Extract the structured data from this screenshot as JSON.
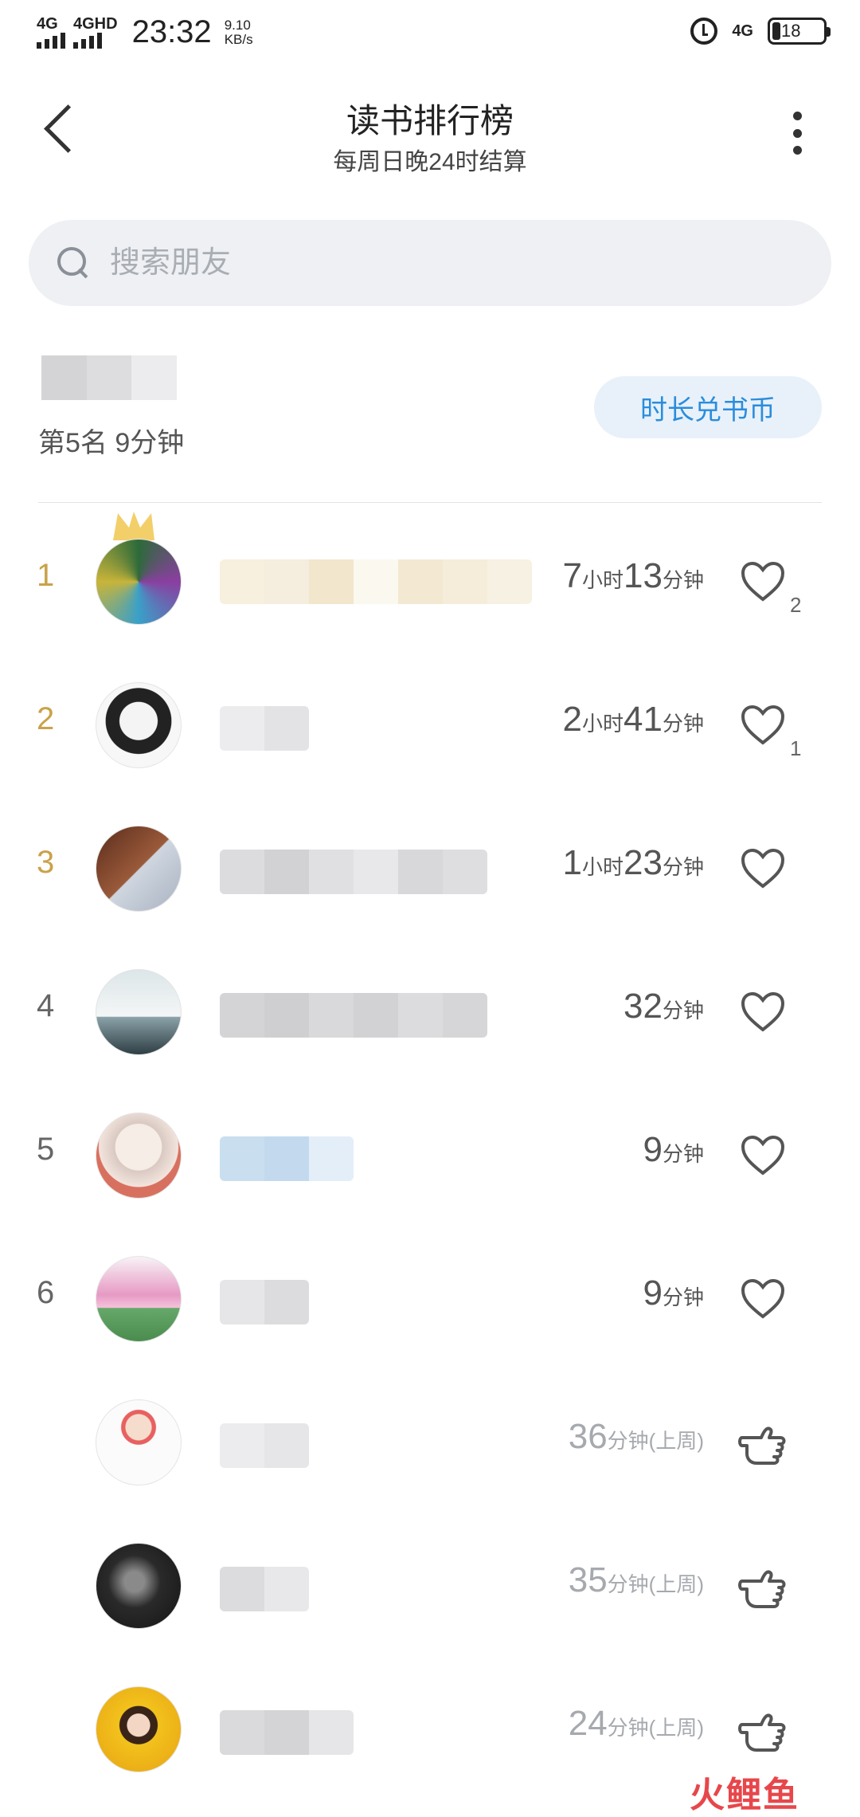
{
  "status_bar": {
    "signal1": "4G",
    "signal2": "4GHD",
    "time": "23:32",
    "speed_value": "9.10",
    "speed_unit": "KB/s",
    "network": "4G",
    "battery": "18"
  },
  "header": {
    "title": "读书排行榜",
    "subtitle": "每周日晚24时结算"
  },
  "search": {
    "placeholder": "搜索朋友"
  },
  "my_rank": {
    "rank_text": "第5名 9分钟",
    "exchange_button": "时长兑书币"
  },
  "rows": [
    {
      "rank": "1",
      "d1": "7",
      "u1": "小时",
      "d2": "13",
      "u2": "分钟",
      "likes": "2",
      "action": "like"
    },
    {
      "rank": "2",
      "d1": "2",
      "u1": "小时",
      "d2": "41",
      "u2": "分钟",
      "likes": "1",
      "action": "like"
    },
    {
      "rank": "3",
      "d1": "1",
      "u1": "小时",
      "d2": "23",
      "u2": "分钟",
      "likes": "",
      "action": "like"
    },
    {
      "rank": "4",
      "d1": "",
      "u1": "",
      "d2": "32",
      "u2": "分钟",
      "likes": "",
      "action": "like"
    },
    {
      "rank": "5",
      "d1": "",
      "u1": "",
      "d2": "9",
      "u2": "分钟",
      "likes": "",
      "action": "like"
    },
    {
      "rank": "6",
      "d1": "",
      "u1": "",
      "d2": "9",
      "u2": "分钟",
      "likes": "",
      "action": "like"
    },
    {
      "rank": "",
      "d1": "",
      "u1": "",
      "d2": "36",
      "u2": "分钟(上周)",
      "likes": "",
      "action": "poke"
    },
    {
      "rank": "",
      "d1": "",
      "u1": "",
      "d2": "35",
      "u2": "分钟(上周)",
      "likes": "",
      "action": "poke"
    },
    {
      "rank": "",
      "d1": "",
      "u1": "",
      "d2": "24",
      "u2": "分钟(上周)",
      "likes": "",
      "action": "poke"
    }
  ],
  "watermark": "火鲤鱼"
}
